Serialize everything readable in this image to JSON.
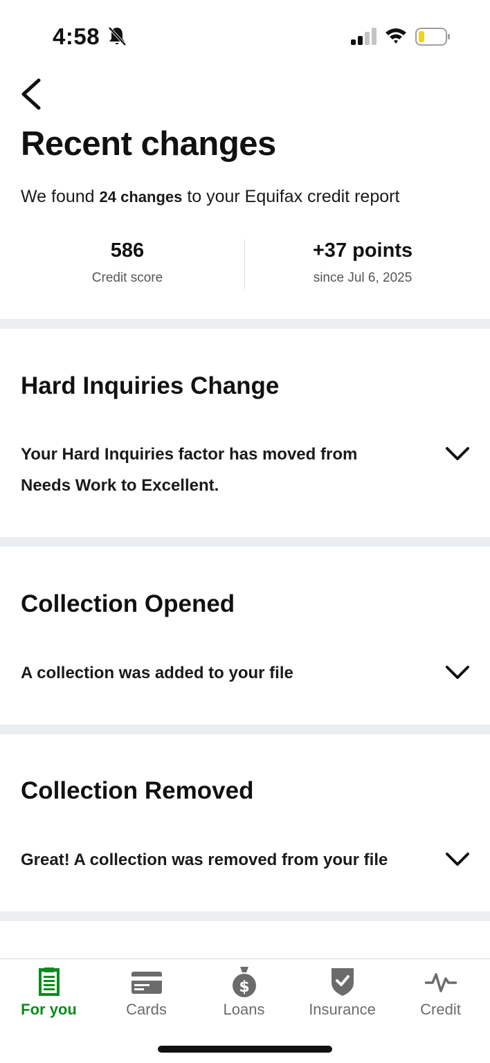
{
  "status_bar": {
    "time": "4:58"
  },
  "header": {
    "back_icon": "chevron-left-icon",
    "title": "Recent changes",
    "summary_prefix": "We found",
    "summary_count": "24 changes",
    "summary_suffix": "to your Equifax credit report"
  },
  "stats": {
    "score_value": "586",
    "score_label": "Credit score",
    "change_value": "+37 points",
    "change_label": "since Jul 6, 2025"
  },
  "changes": [
    {
      "title": "Hard Inquiries Change",
      "description": "Your Hard Inquiries factor has moved from Needs Work to Excellent."
    },
    {
      "title": "Collection Opened",
      "description": "A collection was added to your file"
    },
    {
      "title": "Collection Removed",
      "description": "Great! A collection was removed from your file"
    }
  ],
  "tabs": [
    {
      "label": "For you",
      "icon": "document-icon",
      "active": true
    },
    {
      "label": "Cards",
      "icon": "credit-card-icon",
      "active": false
    },
    {
      "label": "Loans",
      "icon": "money-bag-icon",
      "active": false
    },
    {
      "label": "Insurance",
      "icon": "shield-check-icon",
      "active": false
    },
    {
      "label": "Credit",
      "icon": "pulse-icon",
      "active": false
    }
  ],
  "colors": {
    "accent": "#0a8a1f",
    "inactive": "#6b6b6b",
    "band": "#eaeef1"
  }
}
